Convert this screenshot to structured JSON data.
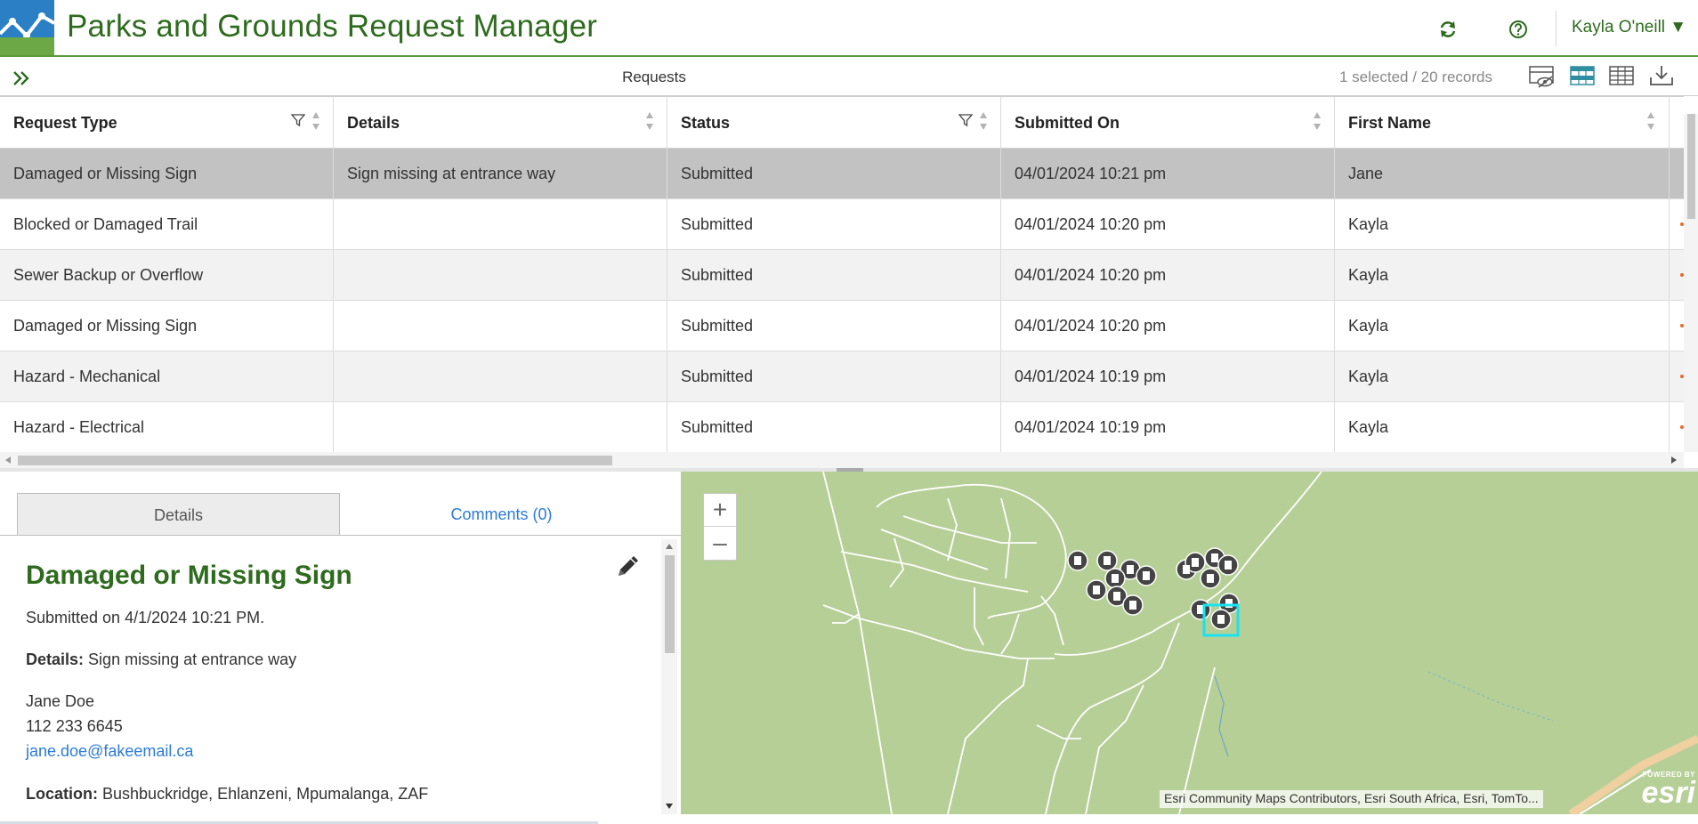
{
  "header": {
    "title": "Parks and Grounds Request Manager",
    "user_name": "Kayla O'neill",
    "user_caret": "▼",
    "refresh_icon": "refresh-icon",
    "help_icon": "help-icon",
    "brand_color": "#2e6b1e"
  },
  "table": {
    "title": "Requests",
    "record_count": "1 selected / 20 records",
    "columns": [
      "Request Type",
      "Details",
      "Status",
      "Submitted On",
      "First Name"
    ],
    "rows": [
      {
        "type": "Damaged or Missing Sign",
        "details": "Sign missing at entrance way",
        "status": "Submitted",
        "submitted": "04/01/2024 10:21 pm",
        "first_name": "Jane"
      },
      {
        "type": "Blocked or Damaged Trail",
        "details": "",
        "status": "Submitted",
        "submitted": "04/01/2024 10:20 pm",
        "first_name": "Kayla"
      },
      {
        "type": "Sewer Backup or Overflow",
        "details": "",
        "status": "Submitted",
        "submitted": "04/01/2024 10:20 pm",
        "first_name": "Kayla"
      },
      {
        "type": "Damaged or Missing Sign",
        "details": "",
        "status": "Submitted",
        "submitted": "04/01/2024 10:20 pm",
        "first_name": "Kayla"
      },
      {
        "type": "Hazard - Mechanical",
        "details": "",
        "status": "Submitted",
        "submitted": "04/01/2024 10:19 pm",
        "first_name": "Kayla"
      },
      {
        "type": "Hazard - Electrical",
        "details": "",
        "status": "Submitted",
        "submitted": "04/01/2024 10:19 pm",
        "first_name": "Kayla"
      }
    ]
  },
  "panel": {
    "tab_details": "Details",
    "tab_comments": "Comments (0)",
    "title": "Damaged or Missing Sign",
    "submitted_on": "Submitted on 4/1/2024 10:21 PM.",
    "details_label": "Details:",
    "details_value": "Sign missing at entrance way",
    "name": "Jane Doe",
    "phone": "112 233 6645",
    "email": "jane.doe@fakeemail.ca",
    "location_label": "Location:",
    "location_value": "Bushbuckridge, Ehlanzeni, Mpumalanga, ZAF"
  },
  "map": {
    "zoom_in": "+",
    "zoom_out": "–",
    "attribution": "Esri Community Maps Contributors, Esri South Africa, Esri, TomTo...",
    "powered_by": "POWERED BY",
    "esri_logo": "esri"
  }
}
